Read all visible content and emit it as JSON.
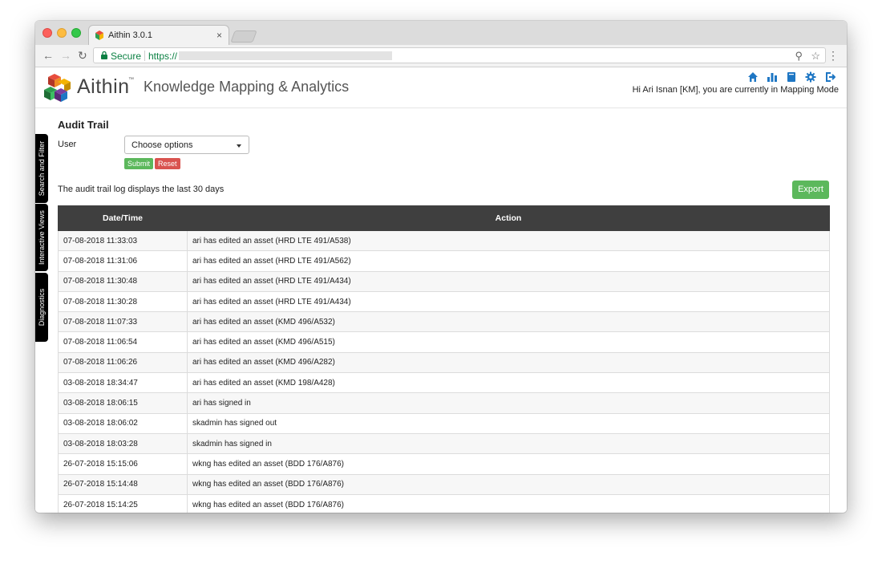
{
  "browser": {
    "tab_title": "Aithin 3.0.1",
    "tab_close": "×",
    "secure_label": "Secure",
    "url_scheme": "https://",
    "icons": [
      "back-icon",
      "forward-icon",
      "reload-icon",
      "lock-icon",
      "search-icon",
      "star-icon",
      "menu-icon"
    ]
  },
  "header": {
    "logo_text": "Aithin",
    "logo_tm": "™",
    "app_title": "Knowledge Mapping & Analytics",
    "greeting": "Hi Ari Isnan [KM], you are currently in Mapping Mode",
    "icon_color": "#1f77c4",
    "icons": [
      "home-icon",
      "chart-icon",
      "book-icon",
      "gear-icon",
      "logout-icon"
    ]
  },
  "side_tabs": [
    "Search and Filter",
    "Interactive Views",
    "Diagnostics"
  ],
  "audit": {
    "title": "Audit Trail",
    "user_label": "User",
    "user_select_value": "Choose options",
    "submit_label": "Submit",
    "reset_label": "Reset",
    "note": "The audit trail log displays the last 30 days",
    "export_label": "Export",
    "columns": [
      "Date/Time",
      "Action"
    ],
    "rows": [
      [
        "07-08-2018 11:33:03",
        "ari has edited an asset (HRD LTE 491/A538)"
      ],
      [
        "07-08-2018 11:31:06",
        "ari has edited an asset (HRD LTE 491/A562)"
      ],
      [
        "07-08-2018 11:30:48",
        "ari has edited an asset (HRD LTE 491/A434)"
      ],
      [
        "07-08-2018 11:30:28",
        "ari has edited an asset (HRD LTE 491/A434)"
      ],
      [
        "07-08-2018 11:07:33",
        "ari has edited an asset (KMD 496/A532)"
      ],
      [
        "07-08-2018 11:06:54",
        "ari has edited an asset (KMD 496/A515)"
      ],
      [
        "07-08-2018 11:06:26",
        "ari has edited an asset (KMD 496/A282)"
      ],
      [
        "03-08-2018 18:34:47",
        "ari has edited an asset (KMD 198/A428)"
      ],
      [
        "03-08-2018 18:06:15",
        "ari has signed in"
      ],
      [
        "03-08-2018 18:06:02",
        "skadmin has signed out"
      ],
      [
        "03-08-2018 18:03:28",
        "skadmin has signed in"
      ],
      [
        "26-07-2018 15:15:06",
        "wkng has edited an asset (BDD 176/A876)"
      ],
      [
        "26-07-2018 15:14:48",
        "wkng has edited an asset (BDD 176/A876)"
      ],
      [
        "26-07-2018 15:14:25",
        "wkng has edited an asset (BDD 176/A876)"
      ]
    ]
  }
}
